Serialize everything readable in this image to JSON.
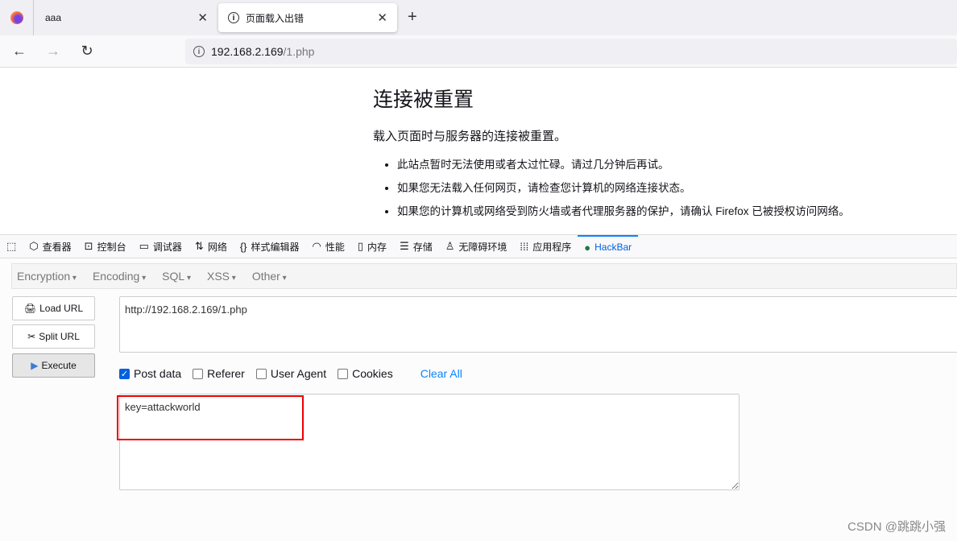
{
  "browser": {
    "tabs": [
      {
        "label": "aaa"
      },
      {
        "label": "页面载入出错",
        "active": true
      }
    ],
    "url_host": "192.168.2.169",
    "url_path": "/1.php"
  },
  "error": {
    "title": "连接被重置",
    "message": "载入页面时与服务器的连接被重置。",
    "bullets": [
      "此站点暂时无法使用或者太过忙碌。请过几分钟后再试。",
      "如果您无法载入任何网页，请检查您计算机的网络连接状态。",
      "如果您的计算机或网络受到防火墙或者代理服务器的保护，请确认 Firefox 已被授权访问网络。"
    ]
  },
  "devtools": {
    "tabs": [
      "查看器",
      "控制台",
      "调试器",
      "网络",
      "样式编辑器",
      "性能",
      "内存",
      "存储",
      "无障碍环境",
      "应用程序",
      "HackBar"
    ],
    "active": "HackBar"
  },
  "hackbar": {
    "menus": [
      "Encryption",
      "Encoding",
      "SQL",
      "XSS",
      "Other"
    ],
    "load_url": "Load URL",
    "split_url": "Split URL",
    "execute": "Execute",
    "url_value": "http://192.168.2.169/1.php",
    "options": [
      {
        "label": "Post data",
        "checked": true
      },
      {
        "label": "Referer",
        "checked": false
      },
      {
        "label": "User Agent",
        "checked": false
      },
      {
        "label": "Cookies",
        "checked": false
      }
    ],
    "clear_all": "Clear All",
    "post_value": "key=attackworld",
    "highlight_color": "#e00000"
  },
  "watermark": "CSDN @跳跳小强"
}
